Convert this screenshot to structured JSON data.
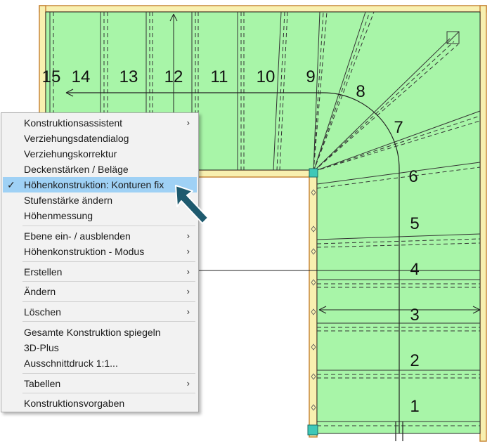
{
  "drawing": {
    "step_numbers": [
      "1",
      "2",
      "3",
      "4",
      "5",
      "6",
      "7",
      "8",
      "9",
      "10",
      "11",
      "12",
      "13",
      "14",
      "15"
    ],
    "colors": {
      "tread_fill": "#a8f5a8",
      "wood": "#f8f0b0",
      "wood_border": "#c8883a",
      "line": "#333333",
      "corner_post": "#3ec8b8"
    }
  },
  "context_menu": {
    "items": [
      {
        "label": "Konstruktionsassistent",
        "submenu": true
      },
      {
        "label": "Verziehungsdatendialog"
      },
      {
        "label": "Verziehungskorrektur"
      },
      {
        "label": "Deckenstärken / Beläge"
      },
      {
        "label": "Höhenkonstruktion: Konturen fix",
        "checked": true,
        "highlighted": true
      },
      {
        "label": "Stufenstärke ändern"
      },
      {
        "label": "Höhenmessung"
      },
      {
        "label": "Ebene ein- / ausblenden",
        "submenu": true
      },
      {
        "label": "Höhenkonstruktion - Modus",
        "submenu": true
      },
      {
        "label": "Erstellen",
        "submenu": true
      },
      {
        "label": "Ändern",
        "submenu": true
      },
      {
        "label": "Löschen",
        "submenu": true
      },
      {
        "label": "Gesamte Konstruktion spiegeln"
      },
      {
        "label": "3D-Plus"
      },
      {
        "label": "Ausschnittdruck 1:1..."
      },
      {
        "label": "Tabellen",
        "submenu": true
      },
      {
        "label": "Konstruktionsvorgaben"
      }
    ],
    "check_glyph": "✓",
    "submenu_glyph": "›",
    "highlight_color": "#9fd1f5"
  },
  "pointer": {
    "color": "#1e5a6e",
    "icon": "arrow-pointer-icon"
  }
}
